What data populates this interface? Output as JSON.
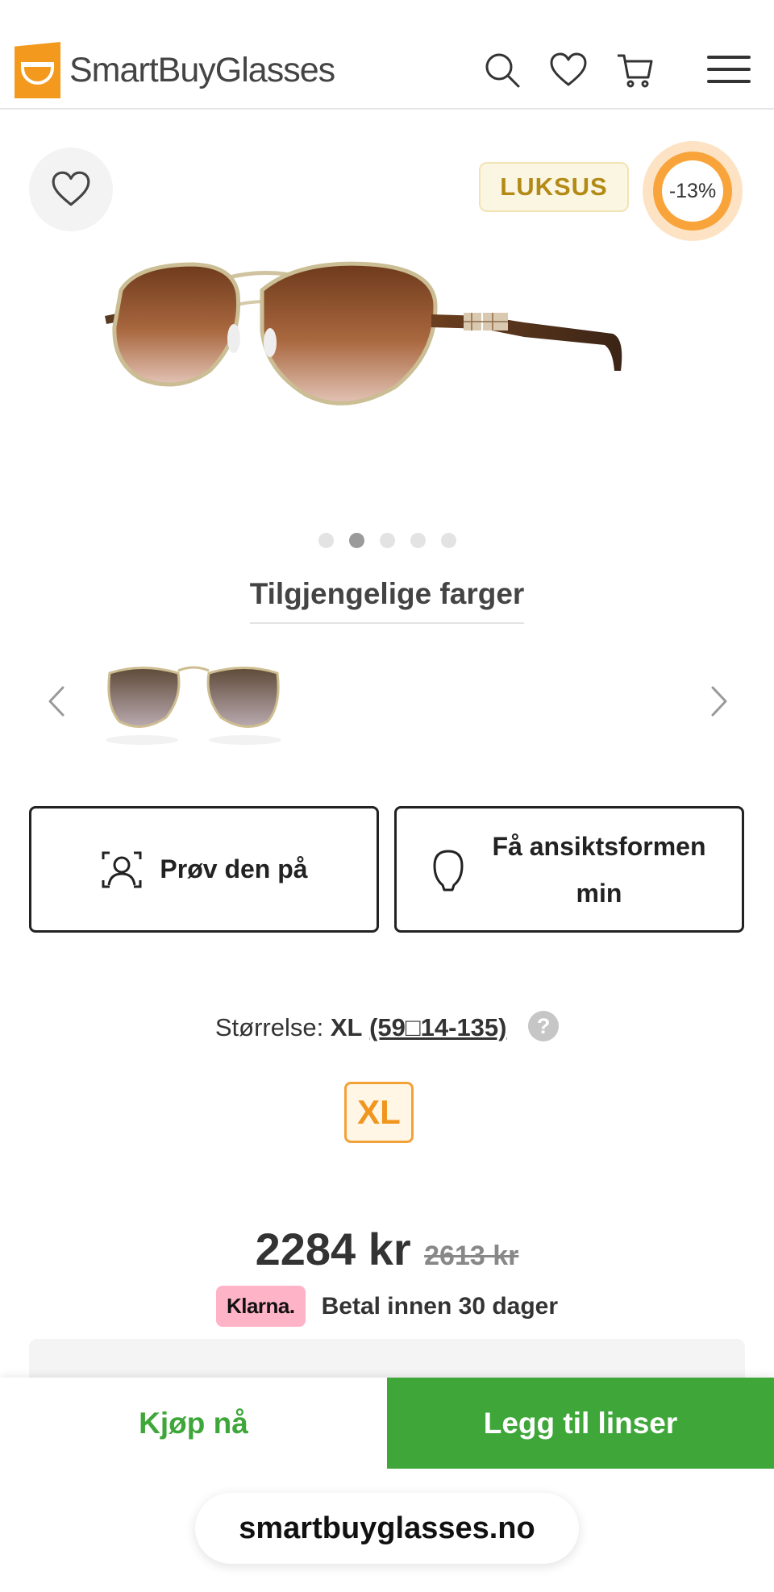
{
  "header": {
    "brand": "SmartBuyGlasses",
    "icons": [
      "search-icon",
      "heart-icon",
      "cart-icon",
      "menu-icon"
    ]
  },
  "product": {
    "badge_luxury": "LUKSUS",
    "discount": "-13%",
    "gallery_total": 5,
    "gallery_active_index": 2
  },
  "colors": {
    "title": "Tilgjengelige farger"
  },
  "actions": {
    "try_on": "Prøv den på",
    "face_shape": "Få ansiktsformen min"
  },
  "size": {
    "label": "Størrelse:",
    "value": "XL",
    "dims": "(59□14-135)",
    "help": "?",
    "chip": "XL"
  },
  "price": {
    "current": "2284 kr",
    "original": "2613 kr"
  },
  "klarna": {
    "logo": "Klarna.",
    "text": "Betal innen 30 dager"
  },
  "bottom": {
    "buy_now": "Kjøp nå",
    "add_lenses": "Legg til linser"
  },
  "browser": {
    "url": "smartbuyglasses.no"
  },
  "colors_theme": {
    "green": "#3fa73a",
    "orange": "#f39a1e",
    "gold": "#b38a16",
    "klarna_pink": "#ffb3c7"
  }
}
